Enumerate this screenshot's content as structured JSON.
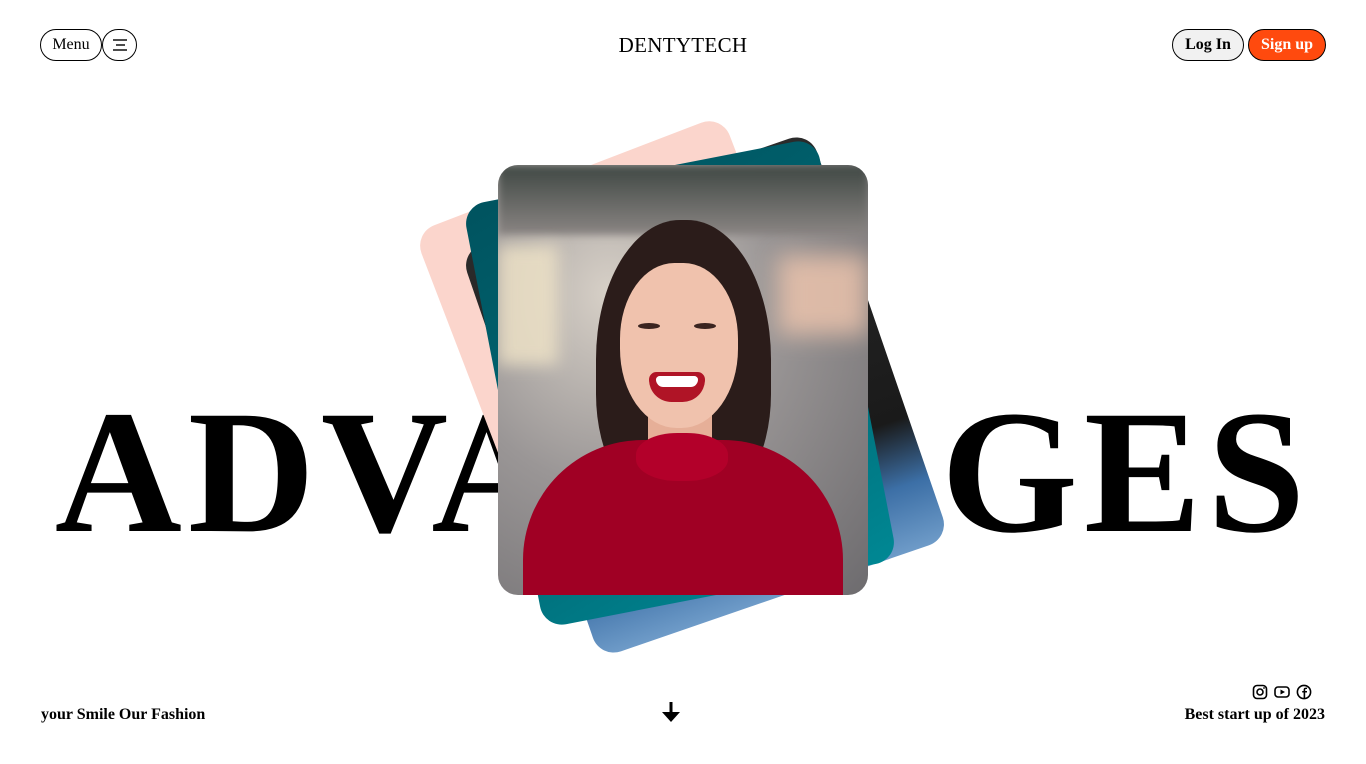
{
  "header": {
    "menu_label": "Menu",
    "logo": "DENTYTECH",
    "login_label": "Log In",
    "signup_label": "Sign up",
    "signup_color": "#ff4a0e"
  },
  "hero": {
    "word": "ADVANTAGES",
    "card_colors": [
      "#fbd5cc",
      "#006b77"
    ]
  },
  "footer": {
    "tagline": "your Smile Our Fashion",
    "right_text": "Best start up of 2023",
    "social_icons": [
      "instagram-icon",
      "youtube-icon",
      "facebook-icon"
    ],
    "scroll_icon": "arrow-down-icon"
  }
}
